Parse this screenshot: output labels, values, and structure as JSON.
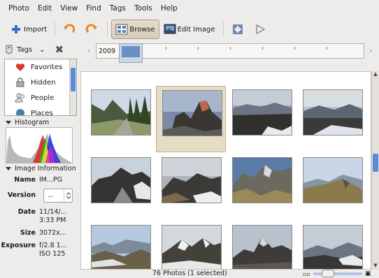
{
  "menu": [
    "Photo",
    "Edit",
    "View",
    "Find",
    "Tags",
    "Tools",
    "Help"
  ],
  "toolbar": {
    "import_label": "Import",
    "browse_label": "Browse",
    "edit_image_label": "Edit Image"
  },
  "sidebar": {
    "tags_label": "Tags",
    "tag_items": [
      "Favorites",
      "Hidden",
      "People",
      "Places"
    ],
    "histogram_label": "Histogram",
    "image_info_label": "Image Information",
    "info": {
      "name_label": "Name",
      "name_value": "IM...PG",
      "version_label": "Version",
      "version_value": "...",
      "date_label": "Date",
      "date_value_1": "11/14/...",
      "date_value_2": "3:33 PM",
      "size_label": "Size",
      "size_value": "3072x...",
      "exposure_label": "Exposure",
      "exposure_value_1": "f/2.8 1...",
      "exposure_value_2": "ISO 125"
    }
  },
  "timeline": {
    "year": "2009"
  },
  "status": {
    "text": "76 Photos (1 selected)"
  },
  "colors": {
    "accent": "#5b8bd6",
    "selection": "#e6dcc6"
  }
}
